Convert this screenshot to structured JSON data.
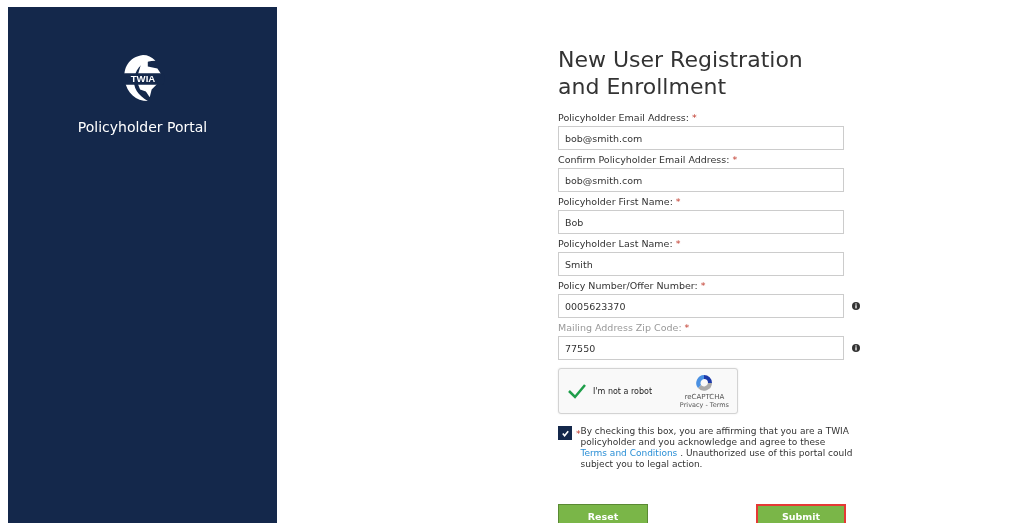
{
  "sidebar": {
    "logo_text": "TWIA",
    "title": "Policyholder Portal"
  },
  "form": {
    "title": "New User Registration and Enrollment",
    "fields": [
      {
        "label": "Policyholder Email Address:",
        "required_mark": "*",
        "value": "bob@smith.com",
        "info": false,
        "dimmed": false
      },
      {
        "label": "Confirm Policyholder Email Address:",
        "required_mark": "*",
        "value": "bob@smith.com",
        "info": false,
        "dimmed": false
      },
      {
        "label": "Policyholder First Name:",
        "required_mark": "*",
        "value": "Bob",
        "info": false,
        "dimmed": false
      },
      {
        "label": "Policyholder Last Name:",
        "required_mark": "*",
        "value": "Smith",
        "info": false,
        "dimmed": false
      },
      {
        "label": "Policy Number/Offer Number:",
        "required_mark": "*",
        "value": "0005623370",
        "info": true,
        "dimmed": false
      },
      {
        "label": "Mailing Address Zip Code:",
        "required_mark": "*",
        "value": "77550",
        "info": true,
        "dimmed": true
      }
    ],
    "captcha": {
      "label": "I'm not a robot",
      "checked": true,
      "brand": "reCAPTCHA",
      "links": "Privacy - Terms"
    },
    "agreement": {
      "checked": true,
      "required_mark": "*",
      "text_before": "By checking this box, you are affirming that you are a TWIA policyholder and you acknowledge and agree to these",
      "link": "Terms and Conditions",
      "text_after": ". Unauthorized use of this portal could subject you to legal action."
    },
    "buttons": [
      {
        "label": "Reset",
        "highlighted": false
      },
      {
        "label": "Submit",
        "highlighted": true
      }
    ]
  }
}
